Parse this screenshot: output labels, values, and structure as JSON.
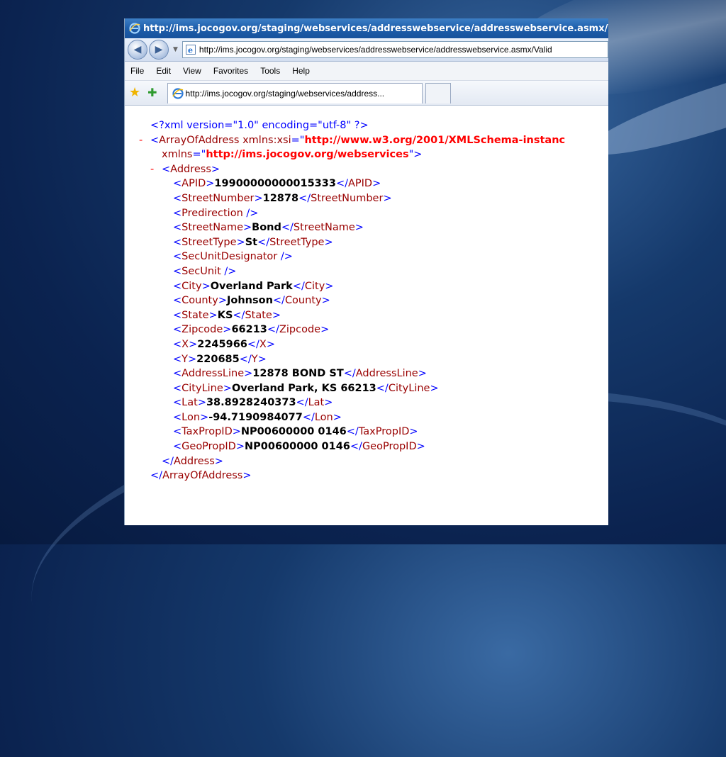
{
  "window": {
    "title": "http://ims.jocogov.org/staging/webservices/addresswebservice/addresswebservice.asmx/Vali",
    "address_url": "http://ims.jocogov.org/staging/webservices/addresswebservice/addresswebservice.asmx/Valid",
    "menu": [
      "File",
      "Edit",
      "View",
      "Favorites",
      "Tools",
      "Help"
    ],
    "tab_label": "http://ims.jocogov.org/staging/webservices/address...",
    "icons": {
      "back": "back-arrow-icon",
      "forward": "forward-arrow-icon",
      "favorites": "star-icon",
      "add_favorites": "add-favorites-icon",
      "page": "ie-page-icon"
    }
  },
  "xml": {
    "declaration": "<?xml version=\"1.0\" encoding=\"utf-8\" ?>",
    "collapse_marker": "-",
    "root_tag": "ArrayOfAddress",
    "attr_xsi_name": "xmlns:xsi",
    "attr_xsi_value": "http://www.w3.org/2001/XMLSchema-instanc",
    "attr_xmlns_name": "xmlns",
    "attr_xmlns_value": "http://ims.jocogov.org/webservices",
    "address_tag": "Address",
    "fields": [
      {
        "tag": "APID",
        "value": "19900000000015333"
      },
      {
        "tag": "StreetNumber",
        "value": "12878"
      },
      {
        "tag": "Predirection",
        "value": null
      },
      {
        "tag": "StreetName",
        "value": "Bond"
      },
      {
        "tag": "StreetType",
        "value": "St"
      },
      {
        "tag": "SecUnitDesignator",
        "value": null
      },
      {
        "tag": "SecUnit",
        "value": null
      },
      {
        "tag": "City",
        "value": "Overland Park"
      },
      {
        "tag": "County",
        "value": "Johnson"
      },
      {
        "tag": "State",
        "value": "KS"
      },
      {
        "tag": "Zipcode",
        "value": "66213"
      },
      {
        "tag": "X",
        "value": "2245966"
      },
      {
        "tag": "Y",
        "value": "220685"
      },
      {
        "tag": "AddressLine",
        "value": "12878 BOND ST"
      },
      {
        "tag": "CityLine",
        "value": "Overland Park, KS 66213"
      },
      {
        "tag": "Lat",
        "value": "38.8928240373"
      },
      {
        "tag": "Lon",
        "value": "-94.7190984077"
      },
      {
        "tag": "TaxPropID",
        "value": "NP00600000 0146"
      },
      {
        "tag": "GeoPropID",
        "value": "NP00600000 0146"
      }
    ]
  },
  "colors": {
    "tag": "#990000",
    "bracket": "#0000ff",
    "attr_value": "#ff0000",
    "title_bar": "#1e5eab"
  }
}
